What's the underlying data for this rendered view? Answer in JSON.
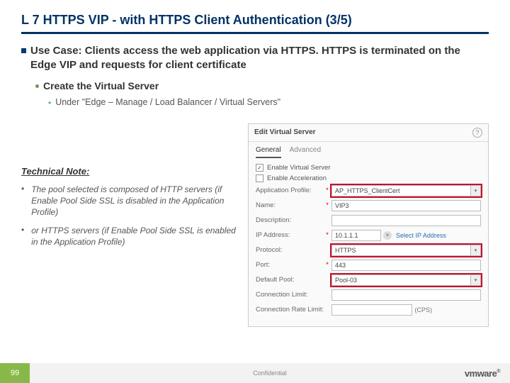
{
  "title": "L 7 HTTPS VIP - with HTTPS Client Authentication (3/5)",
  "usecase": "Use Case: Clients access the web application via HTTPS. HTTPS is terminated on the Edge VIP and requests for client certificate",
  "sub1": "Create the Virtual Server",
  "sub2": "Under \"Edge – Manage /  Load Balancer / Virtual Servers\"",
  "tech_note": {
    "title": "Technical Note:",
    "items": [
      "The pool selected is composed of HTTP servers (if Enable Pool Side SSL is disabled in the Application Profile)",
      "or HTTPS servers (if Enable Pool Side SSL is enabled in the Application Profile)"
    ]
  },
  "dialog": {
    "title": "Edit Virtual Server",
    "tabs": {
      "general": "General",
      "advanced": "Advanced"
    },
    "enable_vs": "Enable Virtual Server",
    "enable_accel": "Enable Acceleration",
    "fields": {
      "app_profile": {
        "label": "Application Profile:",
        "value": "AP_HTTPS_ClientCert"
      },
      "name": {
        "label": "Name:",
        "value": "VIP3"
      },
      "description": {
        "label": "Description:",
        "value": ""
      },
      "ip_address": {
        "label": "IP Address:",
        "value": "10.1.1.1",
        "link": "Select IP Address"
      },
      "protocol": {
        "label": "Protocol:",
        "value": "HTTPS"
      },
      "port": {
        "label": "Port:",
        "value": "443"
      },
      "default_pool": {
        "label": "Default Pool:",
        "value": "Pool-03"
      },
      "conn_limit": {
        "label": "Connection Limit:",
        "value": ""
      },
      "conn_rate": {
        "label": "Connection Rate Limit:",
        "value": "",
        "suffix": "(CPS)"
      }
    }
  },
  "footer": {
    "page": "99",
    "conf": "Confidential",
    "logo": "vmware"
  }
}
